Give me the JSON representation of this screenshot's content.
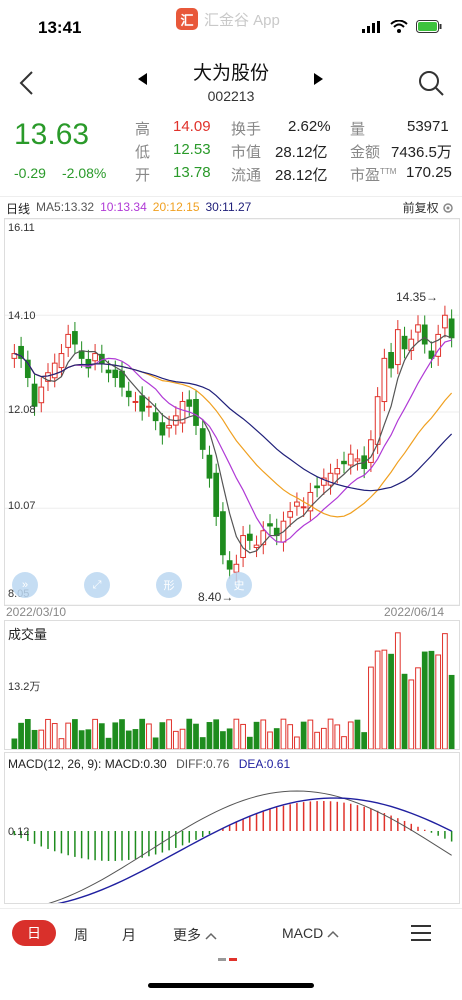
{
  "status": {
    "time": "13:41",
    "app_name": "汇金谷 App",
    "app_logo": "汇"
  },
  "header": {
    "name": "大为股份",
    "code": "002213"
  },
  "quote": {
    "price": "13.63",
    "change": "-0.29",
    "change_pct": "-2.08%",
    "high_label": "高",
    "high": "14.09",
    "low_label": "低",
    "low": "12.53",
    "open_label": "开",
    "open": "13.78",
    "turnover_label": "换手",
    "turnover": "2.62%",
    "mktcap_label": "市值",
    "mktcap": "28.12亿",
    "float_label": "流通",
    "float": "28.12亿",
    "vol_label": "量",
    "vol": "53971",
    "amount_label": "金额",
    "amount": "7436.5万",
    "pe_label": "市盈",
    "pe_sup": "TTM",
    "pe": "170.25"
  },
  "ma": {
    "period": "日线",
    "ma5": "MA5:13.32",
    "ma10": "10:13.34",
    "ma20": "20:12.15",
    "ma30": "30:11.27",
    "adjust": "前复权"
  },
  "colors": {
    "up": "#e0322b",
    "down": "#1e8c1e",
    "ma5": "#555555",
    "ma10": "#b03ad6",
    "ma20": "#f0a020",
    "ma30": "#20207a",
    "accent": "#d9302b"
  },
  "chart_labels": {
    "y_top": "16.11",
    "y2": "14.10",
    "y3": "12.08",
    "y4": "10.07",
    "y_bot": "8.05",
    "max_note": "14.35→",
    "min_note": "8.40→",
    "date_start": "2022/03/10",
    "date_end": "2022/06/14",
    "vol_title": "成交量",
    "vol_level": "13.2万",
    "macd_line": "MACD(12, 26, 9): MACD:0.30",
    "diff": "DIFF:0.76",
    "dea": "DEA:0.61",
    "macd_level": "0.12",
    "btn_expand": "»",
    "btn_full": "⤢",
    "btn_shape": "形",
    "btn_history": "史"
  },
  "bottom": {
    "day": "日",
    "week": "周",
    "month": "月",
    "more": "更多",
    "indicator": "MACD",
    "menu_icon": "menu-icon"
  },
  "chart_data": {
    "type": "candlestick",
    "x_range": [
      "2022/03/10",
      "2022/06/14"
    ],
    "ylim": [
      8.05,
      16.11
    ],
    "y_ticks": [
      16.11,
      14.1,
      12.08,
      10.07,
      8.05
    ],
    "max": 14.35,
    "min": 8.4,
    "last_close": 13.63,
    "ma": {
      "MA5": 13.32,
      "MA10": 13.34,
      "MA20": 12.15,
      "MA30": 11.27
    },
    "macd": {
      "MACD": 0.3,
      "DIFF": 0.76,
      "DEA": 0.61
    },
    "volume_level": "13.2万"
  }
}
